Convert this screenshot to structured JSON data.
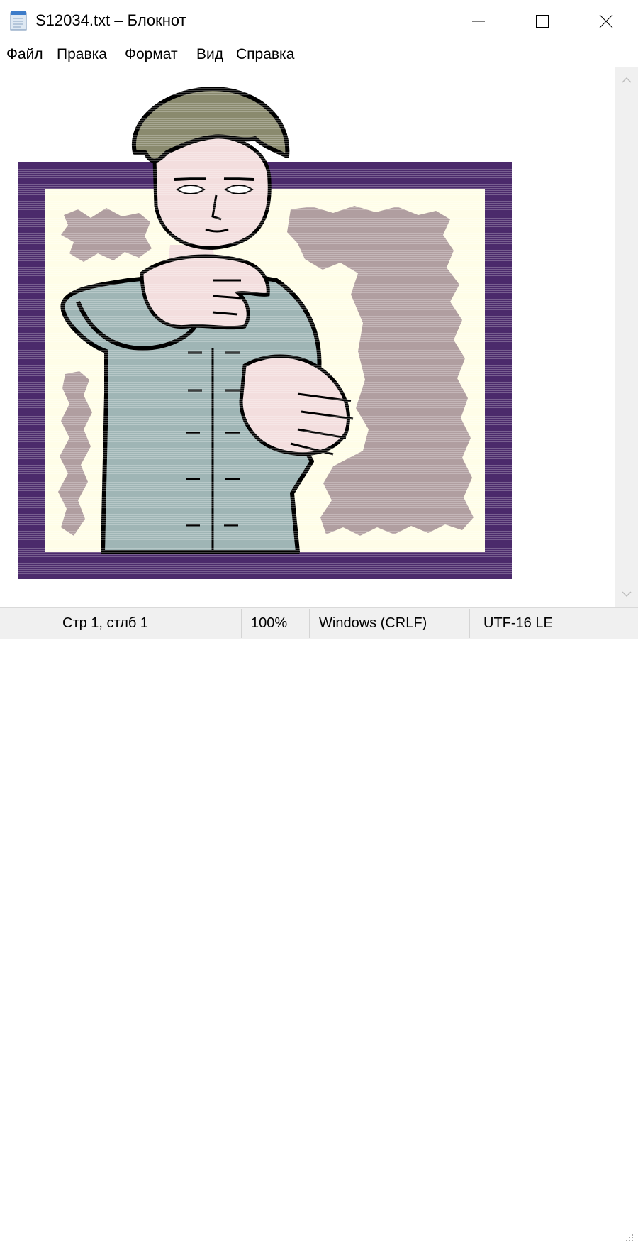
{
  "window": {
    "title": "S12034.txt – Блокнот",
    "icon": "notepad-icon",
    "controls": [
      "minimize-icon",
      "maximize-icon",
      "close-icon"
    ]
  },
  "menu": {
    "items": [
      "Файл",
      "Правка",
      "Формат",
      "Вид",
      "Справка"
    ]
  },
  "document": {
    "content_type": "ascii-art illustration",
    "colors": {
      "frame": "#4b2a6b",
      "background": "#fffde8",
      "splash": "#b09ea0",
      "shirt": "#9fb5b5",
      "hair": "#8a8a6e",
      "skin": "#f3dede",
      "outline": "#000000"
    }
  },
  "statusbar": {
    "position": "Стр 1, стлб 1",
    "zoom": "100%",
    "line_endings": "Windows (CRLF)",
    "encoding": "UTF-16 LE"
  }
}
